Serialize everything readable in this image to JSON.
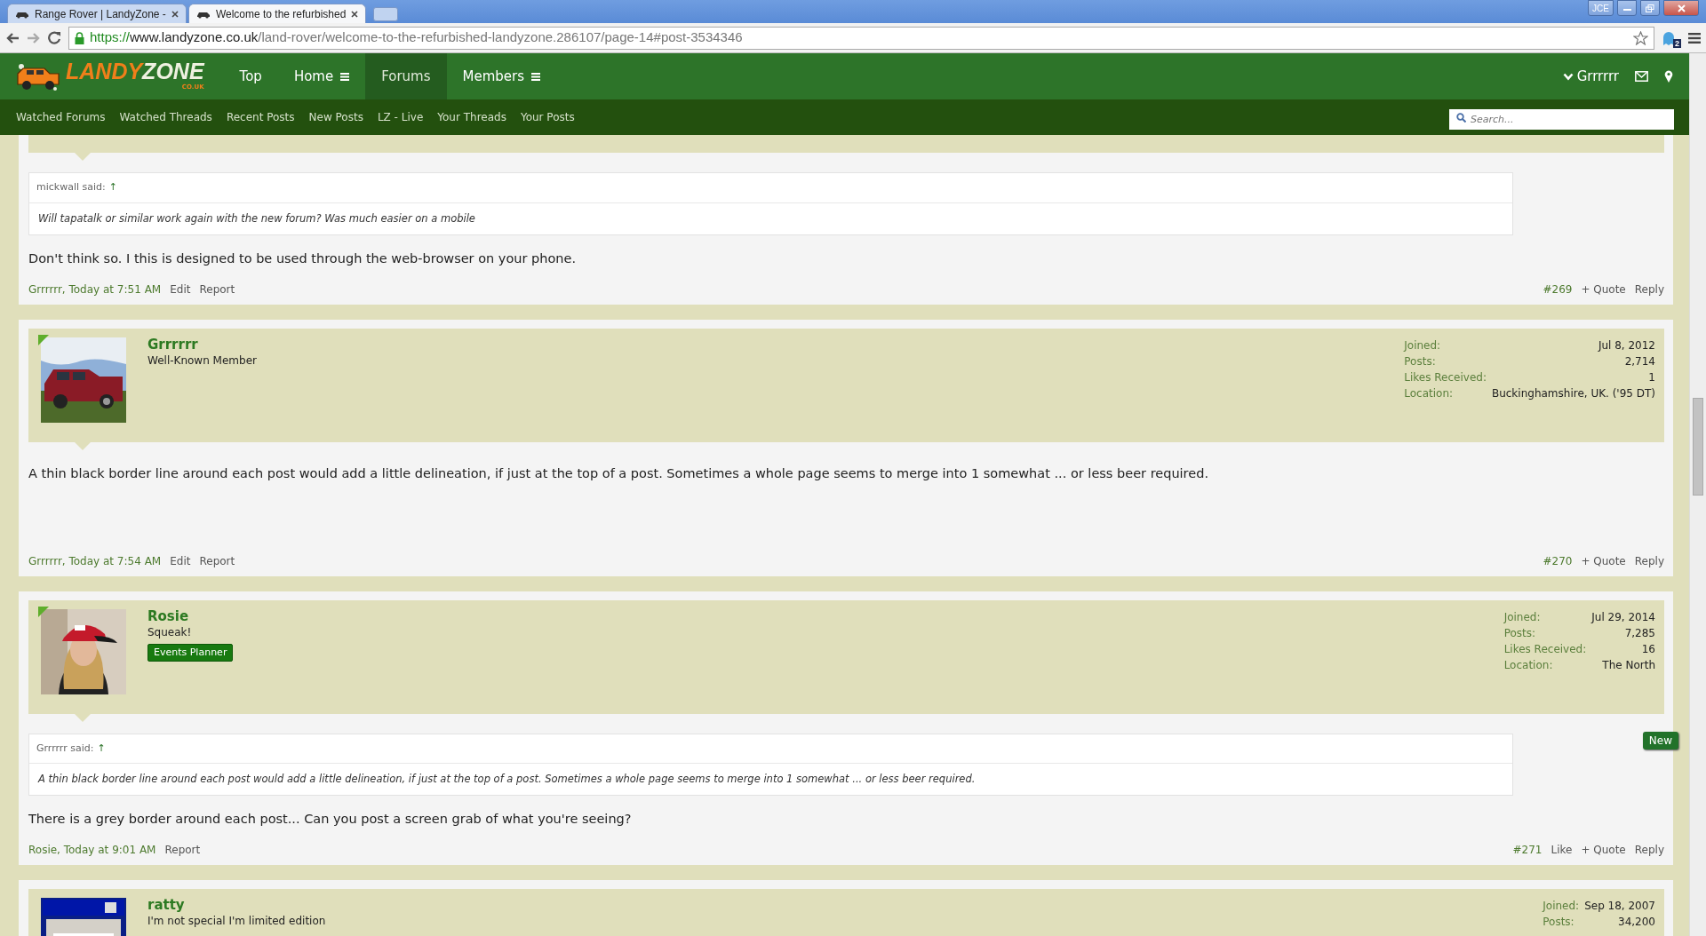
{
  "browser": {
    "tabs": [
      {
        "title": "Range Rover | LandyZone -",
        "selected": false
      },
      {
        "title": "Welcome to the refurbished",
        "selected": true
      }
    ],
    "profile": "JCE",
    "url": {
      "scheme": "https://",
      "host": "www.landyzone.co.uk",
      "path": "/land-rover/welcome-to-the-refurbished-landyzone.286107/page-14#post-3534346"
    },
    "extension_count": "2"
  },
  "site": {
    "logo": {
      "word1": "LANDY",
      "word2": "ZONE",
      "suffix": "CO.UK"
    },
    "nav": [
      {
        "label": "Top",
        "menu": false,
        "selected": false
      },
      {
        "label": "Home",
        "menu": true,
        "selected": false
      },
      {
        "label": "Forums",
        "menu": false,
        "selected": true
      },
      {
        "label": "Members",
        "menu": true,
        "selected": false
      }
    ],
    "user": "Grrrrrr",
    "subnav": [
      "Watched Forums",
      "Watched Threads",
      "Recent Posts",
      "New Posts",
      "LZ - Live",
      "Your Threads",
      "Your Posts"
    ],
    "search": {
      "placeholder": "Search..."
    }
  },
  "posts": [
    {
      "quote": {
        "attribution": "mickwall said:",
        "arrow": "↑",
        "text": "Will tapatalk or similar work again with the new forum? Was much easier on a mobile"
      },
      "body": "Don't think so. I this is designed to be used through the web-browser on your phone.",
      "footer": {
        "author_date": "Grrrrrr, Today at 7:51 AM",
        "left_actions": [
          "Edit",
          "Report"
        ],
        "number": "#269",
        "right_actions": [
          "+ Quote",
          "Reply"
        ]
      }
    },
    {
      "user": {
        "name": "Grrrrrr",
        "title": "Well-Known Member",
        "online": true
      },
      "stats": [
        {
          "label": "Joined:",
          "value": "Jul 8, 2012"
        },
        {
          "label": "Posts:",
          "value": "2,714"
        },
        {
          "label": "Likes Received:",
          "value": "1"
        },
        {
          "label": "Location:",
          "value": "Buckinghamshire, UK. ('95 DT)"
        }
      ],
      "body": "A thin black border line around each post would add a little delineation, if just at the top of a post. Sometimes a whole page seems to merge into 1 somewhat ... or less beer required.",
      "footer": {
        "author_date": "Grrrrrr, Today at 7:54 AM",
        "left_actions": [
          "Edit",
          "Report"
        ],
        "number": "#270",
        "right_actions": [
          "+ Quote",
          "Reply"
        ]
      }
    },
    {
      "user": {
        "name": "Rosie",
        "title": "Squeak!",
        "banner": "Events Planner",
        "online": true
      },
      "stats": [
        {
          "label": "Joined:",
          "value": "Jul 29, 2014"
        },
        {
          "label": "Posts:",
          "value": "7,285"
        },
        {
          "label": "Likes Received:",
          "value": "16"
        },
        {
          "label": "Location:",
          "value": "The North"
        }
      ],
      "new_badge": "New",
      "quote": {
        "attribution": "Grrrrrr said:",
        "arrow": "↑",
        "text": "A thin black border line around each post would add a little delineation, if just at the top of a post. Sometimes a whole page seems to merge into 1 somewhat ... or less beer required."
      },
      "body": "There is a grey border around each post... Can you post a screen grab of what you're seeing?",
      "footer": {
        "author_date": "Rosie, Today at 9:01 AM",
        "left_actions": [
          "Report"
        ],
        "number": "#271",
        "right_actions": [
          "Like",
          "+ Quote",
          "Reply"
        ]
      }
    },
    {
      "user": {
        "name": "ratty",
        "title": "I'm not special I'm limited edition",
        "online": false
      },
      "stats": [
        {
          "label": "Joined:",
          "value": "Sep 18, 2007"
        },
        {
          "label": "Posts:",
          "value": "34,200"
        }
      ]
    }
  ]
}
